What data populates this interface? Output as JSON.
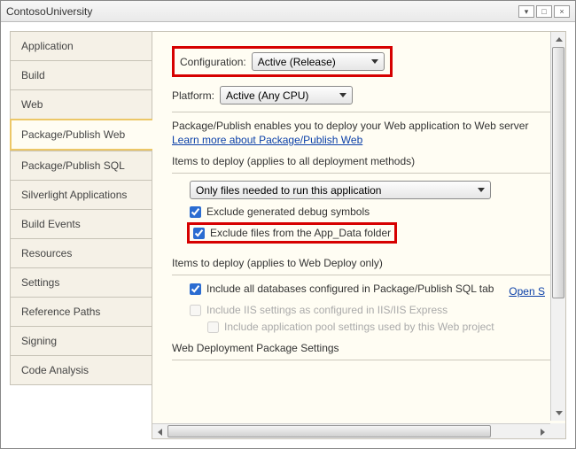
{
  "window": {
    "title": "ContosoUniversity"
  },
  "sidebar": {
    "items": [
      {
        "label": "Application"
      },
      {
        "label": "Build"
      },
      {
        "label": "Web"
      },
      {
        "label": "Package/Publish Web"
      },
      {
        "label": "Package/Publish SQL"
      },
      {
        "label": "Silverlight Applications"
      },
      {
        "label": "Build Events"
      },
      {
        "label": "Resources"
      },
      {
        "label": "Settings"
      },
      {
        "label": "Reference Paths"
      },
      {
        "label": "Signing"
      },
      {
        "label": "Code Analysis"
      }
    ],
    "active_index": 3
  },
  "main": {
    "configuration_label": "Configuration:",
    "configuration_value": "Active (Release)",
    "platform_label": "Platform:",
    "platform_value": "Active (Any CPU)",
    "description": "Package/Publish enables you to deploy your Web application to Web server",
    "learn_more": "Learn more about Package/Publish Web",
    "items_deploy_all_head": "Items to deploy (applies to all deployment methods)",
    "deploy_mode_value": "Only files needed to run this application",
    "exclude_debug": "Exclude generated debug symbols",
    "exclude_appdata": "Exclude files from the App_Data folder",
    "items_deploy_web_head": "Items to deploy (applies to Web Deploy only)",
    "include_db": "Include all databases configured in Package/Publish SQL tab",
    "open_s": "Open S",
    "include_iis": "Include IIS settings as configured in IIS/IIS Express",
    "include_apppool": "Include application pool settings used by this Web project",
    "web_deploy_pkg_head": "Web Deployment Package Settings"
  }
}
